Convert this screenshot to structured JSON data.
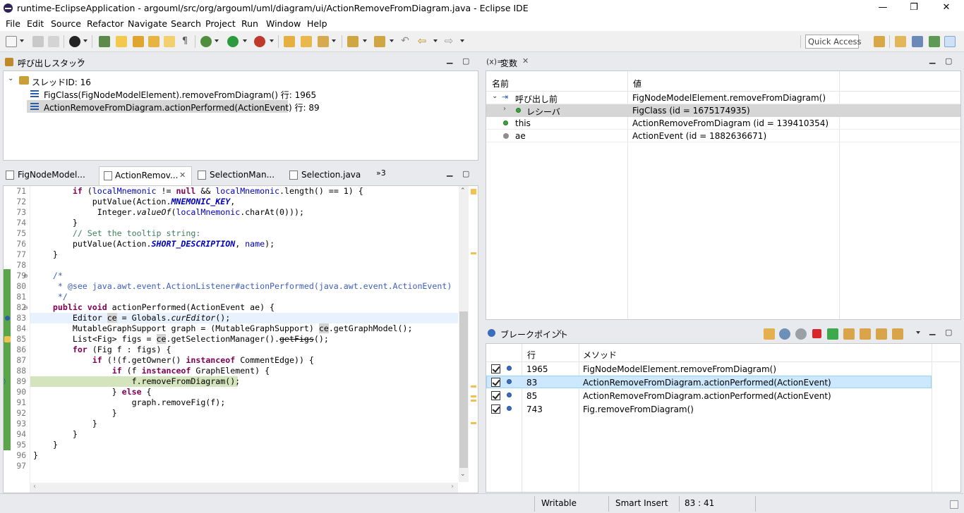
{
  "window": {
    "title": "runtime-EclipseApplication - argouml/src/org/argouml/uml/diagram/ui/ActionRemoveFromDiagram.java - Eclipse IDE",
    "minimize": "—",
    "restore": "❐",
    "close": "✕"
  },
  "menu": [
    "File",
    "Edit",
    "Source",
    "Refactor",
    "Navigate",
    "Search",
    "Project",
    "Run",
    "Window",
    "Help"
  ],
  "toolbar": {
    "quick_access_placeholder": "Quick Access"
  },
  "callstack": {
    "title": "呼び出しスタック",
    "thread": "スレッドID: 16",
    "frames": [
      "FigClass(FigNodeModelElement).removeFromDiagram() 行: 1965",
      "ActionRemoveFromDiagram.actionPerformed(ActionEvent) 行: 89"
    ]
  },
  "editor": {
    "tabs": [
      "FigNodeModel...",
      "ActionRemov...",
      "SelectionMan...",
      "Selection.java"
    ],
    "overflow": "»3",
    "line_numbers": [
      "71",
      "72",
      "73",
      "74",
      "75",
      "76",
      "77",
      "78",
      "79",
      "80",
      "81",
      "82",
      "83",
      "84",
      "85",
      "86",
      "87",
      "88",
      "89",
      "90",
      "91",
      "92",
      "93",
      "94",
      "95",
      "96",
      "97"
    ]
  },
  "variables": {
    "title": "変数",
    "title_prefix": "(x)=",
    "col_name": "名前",
    "col_value": "値",
    "rows": [
      {
        "name": "呼び出し前",
        "value": "FigNodeModelElement.removeFromDiagram()"
      },
      {
        "name": "レシーバ",
        "value": "FigClass  (id = 1675174935)"
      },
      {
        "name": "this",
        "value": "ActionRemoveFromDiagram  (id = 139410354)"
      },
      {
        "name": "ae",
        "value": "ActionEvent  (id = 1882636671)"
      }
    ]
  },
  "breakpoints": {
    "title": "ブレークポイント",
    "col_line": "行",
    "col_method": "メソッド",
    "rows": [
      {
        "line": "1965",
        "method": "FigNodeModelElement.removeFromDiagram()"
      },
      {
        "line": "83",
        "method": "ActionRemoveFromDiagram.actionPerformed(ActionEvent)"
      },
      {
        "line": "85",
        "method": "ActionRemoveFromDiagram.actionPerformed(ActionEvent)"
      },
      {
        "line": "743",
        "method": "Fig.removeFromDiagram()"
      }
    ]
  },
  "status": {
    "mode": "Writable",
    "insert": "Smart Insert",
    "position": "83 : 41"
  },
  "colors": {
    "accent_green": "#3ca23c",
    "exec_line": "#d4e4bc",
    "highlight_line": "#e8f2fe",
    "selection_blue": "#cce8ff"
  }
}
